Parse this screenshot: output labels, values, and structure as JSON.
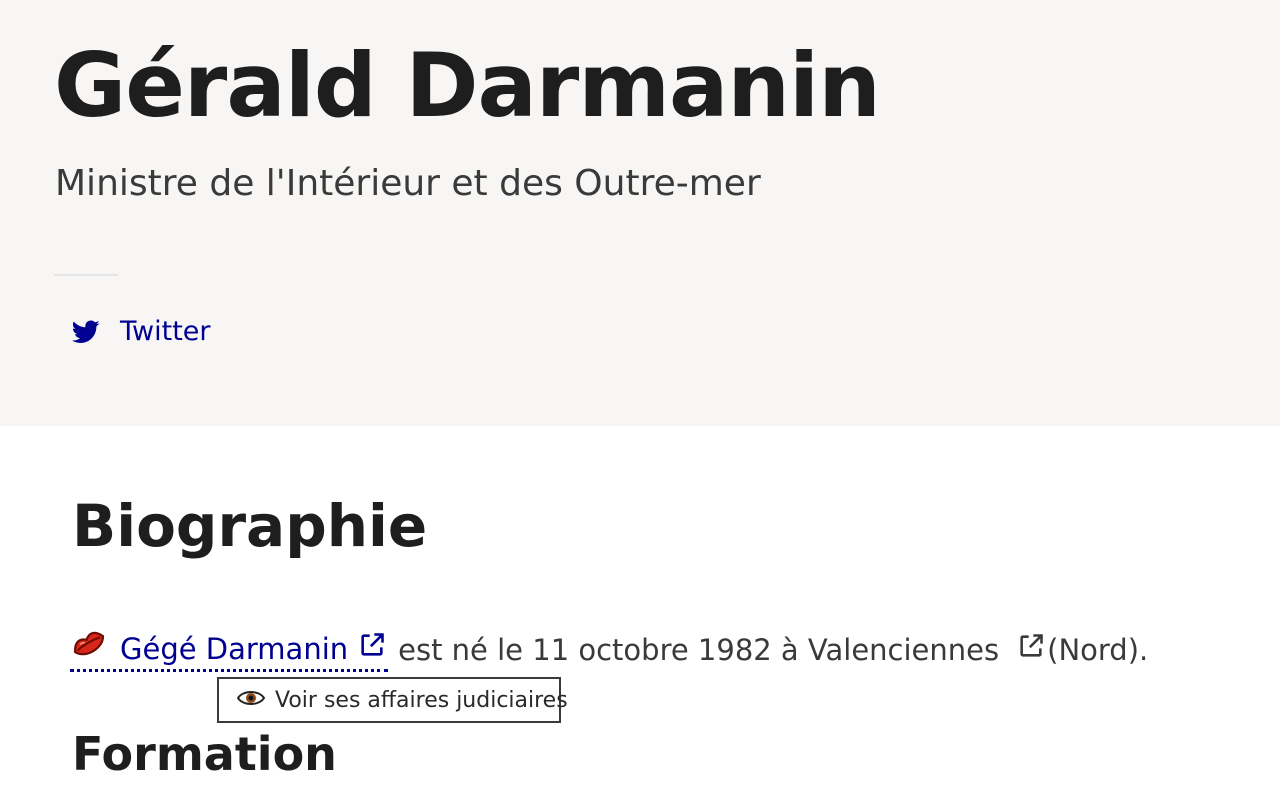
{
  "header": {
    "name": "Gérald Darmanin",
    "role": "Ministre de l'Intérieur et des Outre-mer"
  },
  "social": {
    "twitter_label": "Twitter",
    "icon": "twitter-icon"
  },
  "biography": {
    "heading": "Biographie",
    "nickname_link": "Gégé Darmanin",
    "born_text": "est né le 11 octobre 1982 à Valenciennes",
    "region_text": "(Nord).",
    "lips_icon": "lips-icon",
    "external_link_icon": "external-link-icon"
  },
  "tooltip": {
    "button_label": "Voir ses affaires judiciaires",
    "icon": "eye-icon"
  },
  "formation": {
    "heading": "Formation"
  },
  "colors": {
    "link": "#000091",
    "hero_bg": "#f7f6f5",
    "text": "#1e1e1e"
  }
}
